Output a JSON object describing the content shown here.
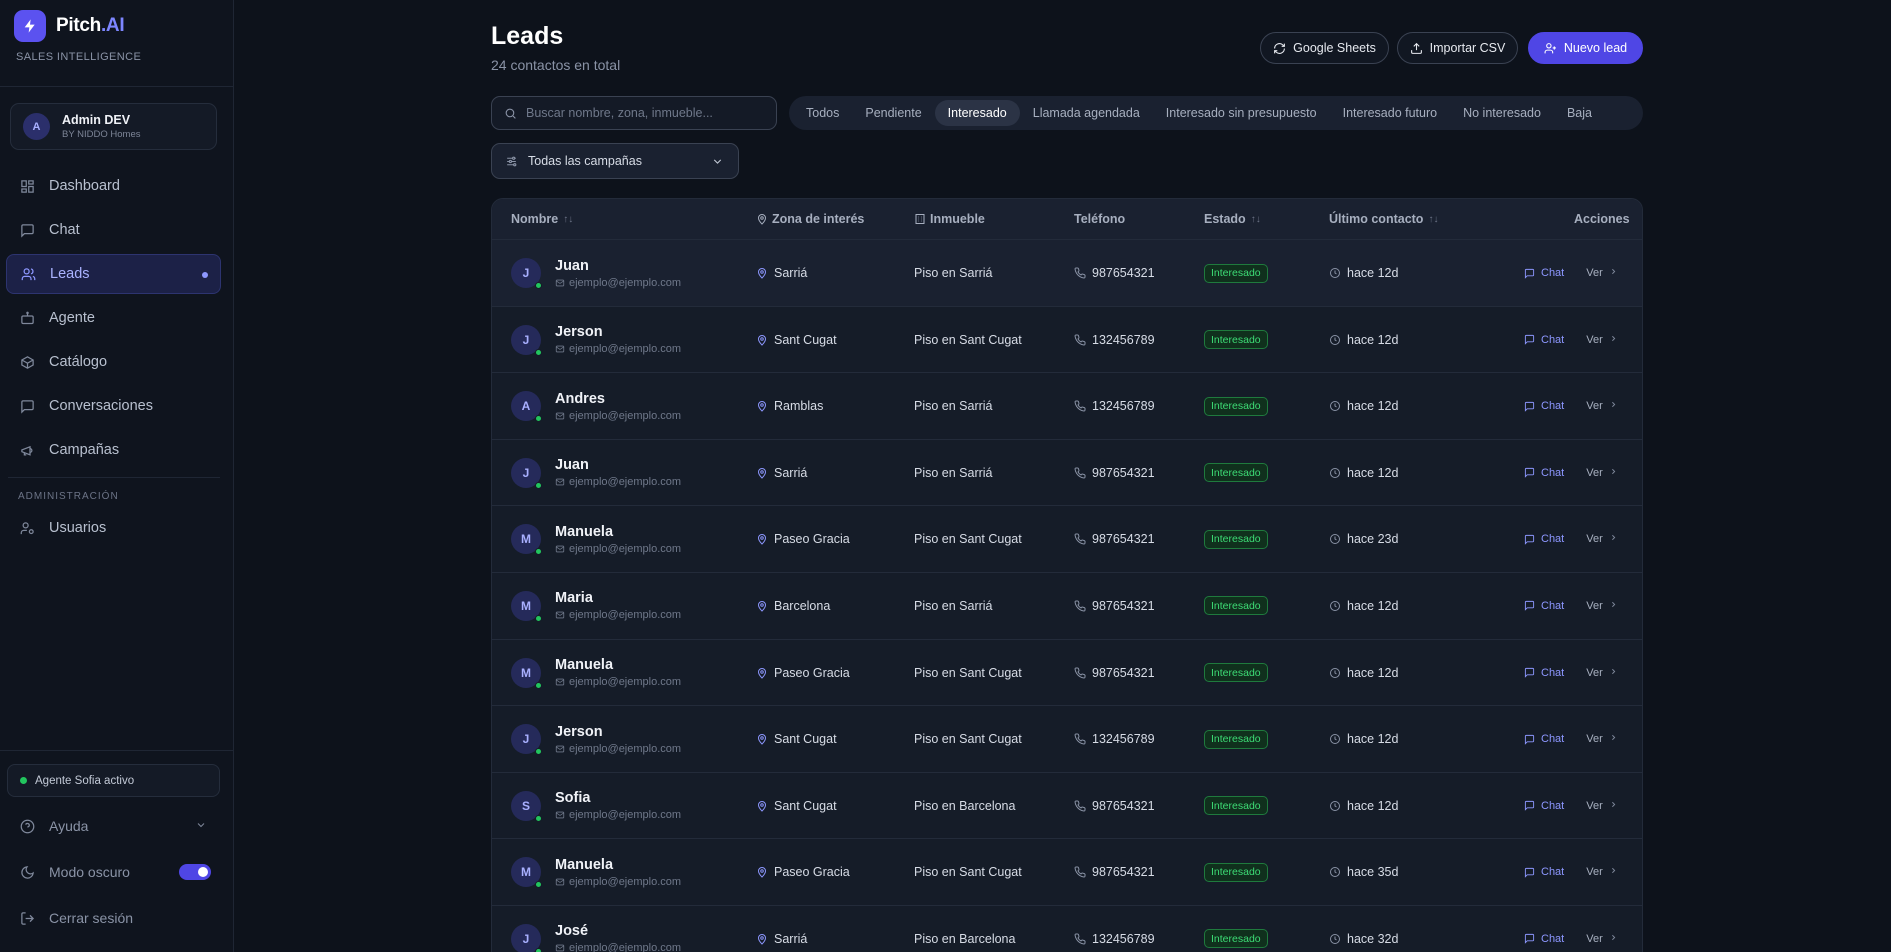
{
  "brand": {
    "name": "Pitch",
    "suffix": ".AI",
    "subtitle": "SALES INTELLIGENCE"
  },
  "user": {
    "initial": "A",
    "name": "Admin DEV",
    "org": "BY NIDDO Homes"
  },
  "nav": [
    {
      "label": "Dashboard",
      "icon": "grid-icon"
    },
    {
      "label": "Chat",
      "icon": "message-icon"
    },
    {
      "label": "Leads",
      "icon": "users-icon",
      "active": true
    },
    {
      "label": "Agente",
      "icon": "bot-icon"
    },
    {
      "label": "Catálogo",
      "icon": "box-icon"
    },
    {
      "label": "Conversaciones",
      "icon": "messages-icon"
    },
    {
      "label": "Campañas",
      "icon": "megaphone-icon"
    }
  ],
  "admin_section": {
    "label": "ADMINISTRACIÓN",
    "items": [
      {
        "label": "Usuarios",
        "icon": "user-cog-icon"
      }
    ]
  },
  "agent_status": "Agente Sofia activo",
  "footer": {
    "help": "Ayuda",
    "dark_mode": "Modo oscuro",
    "logout": "Cerrar sesión"
  },
  "header": {
    "title": "Leads",
    "subtitle": "24 contactos en total",
    "google_sheets": "Google Sheets",
    "import_csv": "Importar CSV",
    "new_lead": "Nuevo lead"
  },
  "search": {
    "placeholder": "Buscar nombre, zona, inmueble..."
  },
  "filters": {
    "tabs": [
      "Todos",
      "Pendiente",
      "Interesado",
      "Llamada agendada",
      "Interesado sin presupuesto",
      "Interesado futuro",
      "No interesado",
      "Baja"
    ],
    "active": "Interesado",
    "campaign": "Todas las campañas"
  },
  "table": {
    "columns": {
      "name": "Nombre",
      "zone": "Zona de interés",
      "property": "Inmueble",
      "phone": "Teléfono",
      "status": "Estado",
      "last_contact": "Último contacto",
      "actions": "Acciones"
    },
    "action_chat": "Chat",
    "action_view": "Ver",
    "rows": [
      {
        "initial": "J",
        "name": "Juan",
        "email": "ejemplo@ejemplo.com",
        "zone": "Sarriá",
        "property": "Piso en Sarriá",
        "phone": "987654321",
        "status": "Interesado",
        "last": "hace 12d"
      },
      {
        "initial": "J",
        "name": "Jerson",
        "email": "ejemplo@ejemplo.com",
        "zone": "Sant Cugat",
        "property": "Piso en Sant Cugat",
        "phone": "132456789",
        "status": "Interesado",
        "last": "hace 12d"
      },
      {
        "initial": "A",
        "name": "Andres",
        "email": "ejemplo@ejemplo.com",
        "zone": "Ramblas",
        "property": "Piso en Sarriá",
        "phone": "132456789",
        "status": "Interesado",
        "last": "hace 12d"
      },
      {
        "initial": "J",
        "name": "Juan",
        "email": "ejemplo@ejemplo.com",
        "zone": "Sarriá",
        "property": "Piso en Sarriá",
        "phone": "987654321",
        "status": "Interesado",
        "last": "hace 12d"
      },
      {
        "initial": "M",
        "name": "Manuela",
        "email": "ejemplo@ejemplo.com",
        "zone": "Paseo Gracia",
        "property": "Piso en Sant Cugat",
        "phone": "987654321",
        "status": "Interesado",
        "last": "hace 23d"
      },
      {
        "initial": "M",
        "name": "Maria",
        "email": "ejemplo@ejemplo.com",
        "zone": "Barcelona",
        "property": "Piso en Sarriá",
        "phone": "987654321",
        "status": "Interesado",
        "last": "hace 12d"
      },
      {
        "initial": "M",
        "name": "Manuela",
        "email": "ejemplo@ejemplo.com",
        "zone": "Paseo Gracia",
        "property": "Piso en Sant Cugat",
        "phone": "987654321",
        "status": "Interesado",
        "last": "hace 12d"
      },
      {
        "initial": "J",
        "name": "Jerson",
        "email": "ejemplo@ejemplo.com",
        "zone": "Sant Cugat",
        "property": "Piso en Sant Cugat",
        "phone": "132456789",
        "status": "Interesado",
        "last": "hace 12d"
      },
      {
        "initial": "S",
        "name": "Sofia",
        "email": "ejemplo@ejemplo.com",
        "zone": "Sant Cugat",
        "property": "Piso en Barcelona",
        "phone": "987654321",
        "status": "Interesado",
        "last": "hace 12d"
      },
      {
        "initial": "M",
        "name": "Manuela",
        "email": "ejemplo@ejemplo.com",
        "zone": "Paseo Gracia",
        "property": "Piso en Sant Cugat",
        "phone": "987654321",
        "status": "Interesado",
        "last": "hace 35d"
      },
      {
        "initial": "J",
        "name": "José",
        "email": "ejemplo@ejemplo.com",
        "zone": "Sarriá",
        "property": "Piso en Barcelona",
        "phone": "132456789",
        "status": "Interesado",
        "last": "hace 32d"
      }
    ]
  },
  "colors": {
    "accent": "#4f46e5",
    "accent_light": "#8d97ff",
    "status_green": "#3ddc75",
    "background": "#0d121b"
  }
}
